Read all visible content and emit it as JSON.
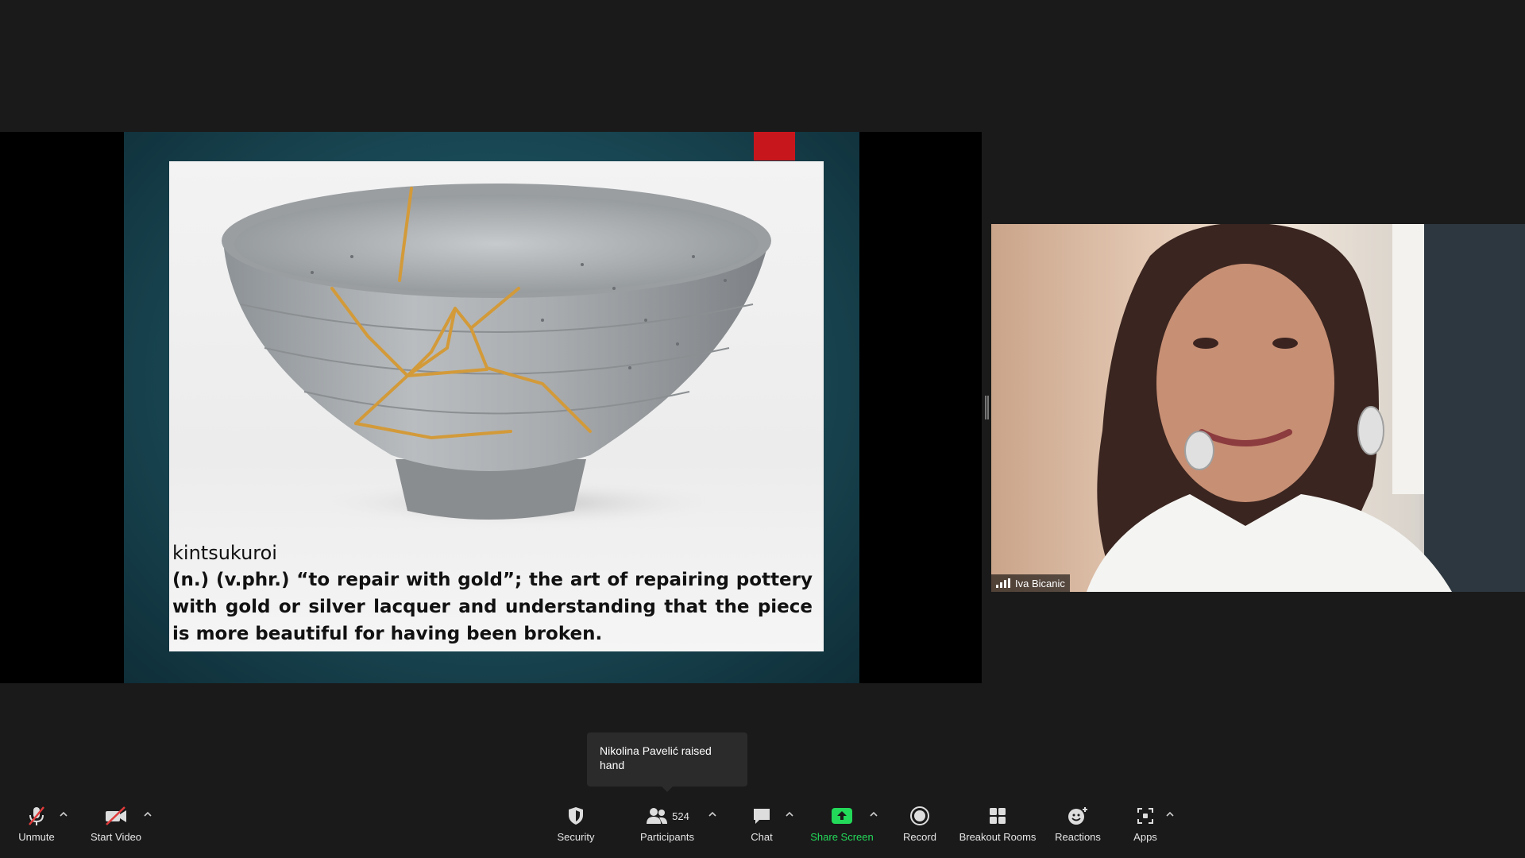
{
  "slide": {
    "title": "kintsukuroi",
    "definition": "(n.) (v.phr.) “to repair with gold”; the art of repairing pottery with gold or silver lacquer and understanding that the piece is more beautiful for having been broken."
  },
  "video": {
    "participant_name": "Iva Bicanic"
  },
  "notification": {
    "text": "Nikolina Pavelić raised hand"
  },
  "toolbar": {
    "unmute": "Unmute",
    "start_video": "Start Video",
    "security": "Security",
    "participants": "Participants",
    "participant_count": "524",
    "chat": "Chat",
    "share_screen": "Share Screen",
    "record": "Record",
    "breakout_rooms": "Breakout Rooms",
    "reactions": "Reactions",
    "apps": "Apps"
  },
  "colors": {
    "background": "#1a1a1a",
    "share_green": "#23d959",
    "muted_red": "#e03b3b",
    "slide_accent_red": "#c8161d"
  },
  "icons": [
    "mic-muted-icon",
    "video-off-icon",
    "shield-icon",
    "participants-icon",
    "chat-icon",
    "share-screen-icon",
    "record-icon",
    "breakout-rooms-icon",
    "reactions-icon",
    "apps-icon",
    "chevron-up-icon",
    "signal-icon"
  ]
}
